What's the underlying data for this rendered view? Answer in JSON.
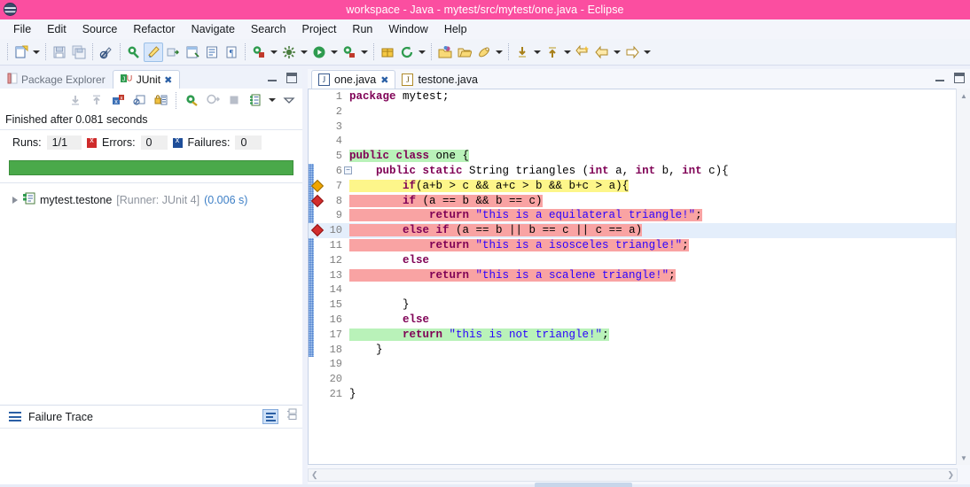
{
  "window": {
    "title": "workspace - Java - mytest/src/mytest/one.java - Eclipse",
    "logo_icon": "eclipse-logo-icon",
    "titlebar_color": "#fb4ea0"
  },
  "menubar": {
    "items": [
      {
        "label": "File",
        "name": "menu-file"
      },
      {
        "label": "Edit",
        "name": "menu-edit"
      },
      {
        "label": "Source",
        "name": "menu-source"
      },
      {
        "label": "Refactor",
        "name": "menu-refactor"
      },
      {
        "label": "Navigate",
        "name": "menu-navigate"
      },
      {
        "label": "Search",
        "name": "menu-search"
      },
      {
        "label": "Project",
        "name": "menu-project"
      },
      {
        "label": "Run",
        "name": "menu-run"
      },
      {
        "label": "Window",
        "name": "menu-window"
      },
      {
        "label": "Help",
        "name": "menu-help"
      }
    ]
  },
  "toolbar": {
    "buttons": [
      "new-wizard-icon",
      "new-dropdown-caret",
      "save-icon",
      "save-all-icon",
      "toggle-markoccurrences-icon",
      "new-java-project-icon",
      "new-java-package-icon",
      "export-icon",
      "open-type-icon",
      "open-task-icon",
      "toggle-breadcrumb-icon",
      "debug-icon",
      "debug-dropdown-caret",
      "external-tools-icon",
      "external-tools-caret",
      "run-icon",
      "run-dropdown-caret",
      "run-as-icon",
      "run-as-caret",
      "new-annotation-icon",
      "refresh-icon",
      "refresh-caret",
      "open-resource-icon",
      "open-folder-icon",
      "search-icon",
      "search-caret",
      "next-annotation-icon",
      "next-annotation-caret",
      "previous-annotation-icon",
      "previous-annotation-caret",
      "last-edit-icon",
      "back-icon",
      "back-caret",
      "forward-icon",
      "forward-caret"
    ]
  },
  "junit_view": {
    "tabs": [
      {
        "label": "Package Explorer",
        "icon": "package-explorer-icon",
        "active": false,
        "closable": false
      },
      {
        "label": "JUnit",
        "icon": "junit-icon",
        "active": true,
        "closable": true
      }
    ],
    "tab_controls": [
      "minimize-icon",
      "maximize-icon"
    ],
    "toolbar_icons": [
      "next-failure-icon",
      "previous-failure-icon",
      "show-failures-only-icon",
      "show-tests-in-hierarchy-icon",
      "scroll-lock-icon",
      "rerun-test-icon",
      "rerun-failed-tests-icon",
      "stop-icon",
      "test-run-history-icon",
      "view-menu-caret",
      "minimize-view-caret"
    ],
    "status_text": "Finished after 0.081 seconds",
    "counters": {
      "runs_label": "Runs:",
      "runs_value": "1/1",
      "errors_label": "Errors:",
      "errors_value": "0",
      "errors_icon": "error-square-icon",
      "failures_label": "Failures:",
      "failures_value": "0",
      "failures_icon": "failure-square-icon"
    },
    "progress": {
      "percent": 100,
      "color": "#4aa94a"
    },
    "tree": [
      {
        "name": "mytest.testone",
        "runner": "[Runner: JUnit 4]",
        "time": "(0.006 s)",
        "icon": "test-class-icon",
        "expander": "collapsed-twisty-icon"
      }
    ],
    "failure_trace": {
      "title": "Failure Trace",
      "icon": "failure-trace-icon",
      "controls": [
        "filter-stack-trace-icon",
        "view-menu-icon"
      ]
    }
  },
  "editor": {
    "tabs": [
      {
        "label": "one.java",
        "icon": "java-file-icon",
        "active": true,
        "closable": true
      },
      {
        "label": "testone.java",
        "icon": "java-file-warning-icon",
        "active": false,
        "closable": false
      }
    ],
    "tab_controls": [
      "minimize-icon",
      "maximize-icon"
    ],
    "scroll": {
      "up_arrow": "scroll-up-icon",
      "down_arrow": "scroll-down-icon",
      "left_arrow": "scroll-left-icon",
      "right_arrow": "scroll-right-icon"
    },
    "current_line": 10,
    "lines": [
      {
        "n": 1,
        "indent": 0,
        "tokens": [
          {
            "t": "package ",
            "c": "kw"
          },
          {
            "t": "mytest;",
            "c": "pl"
          }
        ]
      },
      {
        "n": 2,
        "indent": 0,
        "tokens": []
      },
      {
        "n": 3,
        "indent": 0,
        "tokens": []
      },
      {
        "n": 4,
        "indent": 0,
        "tokens": []
      },
      {
        "n": 5,
        "indent": 0,
        "hl": "green",
        "tokens": [
          {
            "t": "public ",
            "c": "kw"
          },
          {
            "t": "class ",
            "c": "kw"
          },
          {
            "t": "one {",
            "c": "pl"
          }
        ]
      },
      {
        "n": 6,
        "indent": 0,
        "fold": true,
        "change": true,
        "tokens": [
          {
            "t": "    ",
            "c": "pl"
          },
          {
            "t": "public ",
            "c": "kw"
          },
          {
            "t": "static ",
            "c": "kw"
          },
          {
            "t": "String triangles (",
            "c": "pl"
          },
          {
            "t": "int",
            "c": "kw"
          },
          {
            "t": " a, ",
            "c": "pl"
          },
          {
            "t": "int",
            "c": "kw"
          },
          {
            "t": " b, ",
            "c": "pl"
          },
          {
            "t": "int",
            "c": "kw"
          },
          {
            "t": " c){",
            "c": "pl"
          }
        ]
      },
      {
        "n": 7,
        "indent": 0,
        "hl": "yellow",
        "marker": "orange",
        "change": true,
        "tokens": [
          {
            "t": "        ",
            "c": "pl"
          },
          {
            "t": "if",
            "c": "kw"
          },
          {
            "t": "(a+b > c && a+c > b && b+c > a){",
            "c": "pl"
          }
        ]
      },
      {
        "n": 8,
        "indent": 0,
        "hl": "red",
        "marker": "red",
        "change": true,
        "tokens": [
          {
            "t": "        ",
            "c": "pl"
          },
          {
            "t": "if",
            "c": "kw"
          },
          {
            "t": " (a == b && b == c)",
            "c": "pl"
          }
        ]
      },
      {
        "n": 9,
        "indent": 0,
        "hl": "red",
        "change": true,
        "tokens": [
          {
            "t": "            ",
            "c": "pl"
          },
          {
            "t": "return ",
            "c": "kw"
          },
          {
            "t": "\"this is a equilateral triangle!\"",
            "c": "str"
          },
          {
            "t": ";",
            "c": "pl"
          }
        ]
      },
      {
        "n": 10,
        "indent": 0,
        "hl": "red",
        "marker": "red",
        "change": true,
        "current": true,
        "tokens": [
          {
            "t": "        ",
            "c": "pl"
          },
          {
            "t": "else ",
            "c": "kw"
          },
          {
            "t": "if",
            "c": "kw"
          },
          {
            "t": " (a == b || b == c || c == a)",
            "c": "pl"
          }
        ]
      },
      {
        "n": 11,
        "indent": 0,
        "hl": "red",
        "change": true,
        "tokens": [
          {
            "t": "            ",
            "c": "pl"
          },
          {
            "t": "return ",
            "c": "kw"
          },
          {
            "t": "\"this is a isosceles triangle!\"",
            "c": "str"
          },
          {
            "t": ";",
            "c": "pl"
          }
        ]
      },
      {
        "n": 12,
        "indent": 0,
        "change": true,
        "tokens": [
          {
            "t": "        ",
            "c": "pl"
          },
          {
            "t": "else",
            "c": "kw"
          }
        ]
      },
      {
        "n": 13,
        "indent": 0,
        "hl": "red",
        "change": true,
        "tokens": [
          {
            "t": "            ",
            "c": "pl"
          },
          {
            "t": "return ",
            "c": "kw"
          },
          {
            "t": "\"this is a scalene triangle!\"",
            "c": "str"
          },
          {
            "t": ";",
            "c": "pl"
          }
        ]
      },
      {
        "n": 14,
        "indent": 0,
        "change": true,
        "tokens": []
      },
      {
        "n": 15,
        "indent": 0,
        "change": true,
        "tokens": [
          {
            "t": "        }",
            "c": "pl"
          }
        ]
      },
      {
        "n": 16,
        "indent": 0,
        "change": true,
        "tokens": [
          {
            "t": "        ",
            "c": "pl"
          },
          {
            "t": "else",
            "c": "kw"
          }
        ]
      },
      {
        "n": 17,
        "indent": 0,
        "hl": "green",
        "change": true,
        "tokens": [
          {
            "t": "        ",
            "c": "pl"
          },
          {
            "t": "return ",
            "c": "kw"
          },
          {
            "t": "\"this is not triangle!\"",
            "c": "str"
          },
          {
            "t": ";",
            "c": "pl"
          }
        ]
      },
      {
        "n": 18,
        "indent": 0,
        "change": true,
        "tokens": [
          {
            "t": "    }",
            "c": "pl"
          }
        ]
      },
      {
        "n": 19,
        "indent": 0,
        "tokens": []
      },
      {
        "n": 20,
        "indent": 0,
        "tokens": []
      },
      {
        "n": 21,
        "indent": 0,
        "tokens": [
          {
            "t": "}",
            "c": "pl"
          }
        ]
      }
    ]
  },
  "colors": {
    "keyword": "#7f0055",
    "string": "#2a00ff",
    "highlight_green": "#b9f2b9",
    "highlight_yellow": "#fdf68a",
    "highlight_red": "#f9a3a3",
    "current_line": "#e4eefb"
  }
}
